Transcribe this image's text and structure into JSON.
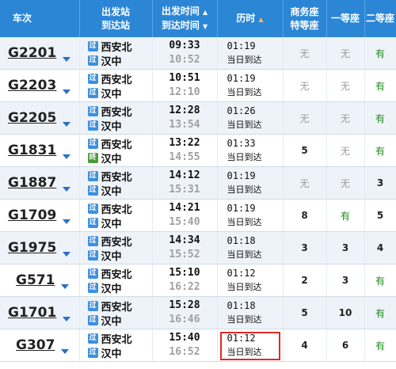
{
  "header": {
    "col_train": "车次",
    "col_from": "出发站",
    "col_to": "到达站",
    "col_dep_time": "出发时间",
    "col_arr_time": "到达时间",
    "col_duration": "历时",
    "col_business": "商务座",
    "col_special": "特等座",
    "col_first": "一等座",
    "col_second": "二等座"
  },
  "rows": [
    {
      "train": "G2201",
      "from": "西安北",
      "to": "汉中",
      "dep": "09:33",
      "arr": "10:52",
      "dur": "01:19",
      "arrive_day": "当日到达",
      "business": "无",
      "first": "无",
      "second": "有",
      "from_badge": "过",
      "to_badge": "过"
    },
    {
      "train": "G2203",
      "from": "西安北",
      "to": "汉中",
      "dep": "10:51",
      "arr": "12:10",
      "dur": "01:19",
      "arrive_day": "当日到达",
      "business": "无",
      "first": "无",
      "second": "有",
      "from_badge": "过",
      "to_badge": "过"
    },
    {
      "train": "G2205",
      "from": "西安北",
      "to": "汉中",
      "dep": "12:28",
      "arr": "13:54",
      "dur": "01:26",
      "arrive_day": "当日到达",
      "business": "无",
      "first": "无",
      "second": "有",
      "from_badge": "过",
      "to_badge": "过"
    },
    {
      "train": "G1831",
      "from": "西安北",
      "to": "汉中",
      "dep": "13:22",
      "arr": "14:55",
      "dur": "01:33",
      "arrive_day": "当日到达",
      "business": "5",
      "first": "无",
      "second": "有",
      "from_badge": "过",
      "to_badge": "终"
    },
    {
      "train": "G1887",
      "from": "西安北",
      "to": "汉中",
      "dep": "14:12",
      "arr": "15:31",
      "dur": "01:19",
      "arrive_day": "当日到达",
      "business": "无",
      "first": "无",
      "second": "3",
      "from_badge": "过",
      "to_badge": "过"
    },
    {
      "train": "G1709",
      "from": "西安北",
      "to": "汉中",
      "dep": "14:21",
      "arr": "15:40",
      "dur": "01:19",
      "arrive_day": "当日到达",
      "business": "8",
      "first": "有",
      "second": "5",
      "from_badge": "过",
      "to_badge": "过"
    },
    {
      "train": "G1975",
      "from": "西安北",
      "to": "汉中",
      "dep": "14:34",
      "arr": "15:52",
      "dur": "01:18",
      "arrive_day": "当日到达",
      "business": "3",
      "first": "3",
      "second": "4",
      "from_badge": "过",
      "to_badge": "过"
    },
    {
      "train": "G571",
      "from": "西安北",
      "to": "汉中",
      "dep": "15:10",
      "arr": "16:22",
      "dur": "01:12",
      "arrive_day": "当日到达",
      "business": "2",
      "first": "3",
      "second": "有",
      "from_badge": "过",
      "to_badge": "过"
    },
    {
      "train": "G1701",
      "from": "西安北",
      "to": "汉中",
      "dep": "15:28",
      "arr": "16:46",
      "dur": "01:18",
      "arrive_day": "当日到达",
      "business": "5",
      "first": "10",
      "second": "有",
      "from_badge": "过",
      "to_badge": "过"
    },
    {
      "train": "G307",
      "from": "西安北",
      "to": "汉中",
      "dep": "15:40",
      "arr": "16:52",
      "dur": "01:12",
      "arrive_day": "当日到达",
      "business": "4",
      "first": "6",
      "second": "有",
      "from_badge": "过",
      "to_badge": "过"
    }
  ],
  "colors": {
    "header_bg": "#2b86d6",
    "highlight": "#e02a2a",
    "have": "#1d8a1d",
    "pass_badge": "#3d8fde",
    "end_badge": "#4a9a3c"
  },
  "icons": {
    "sort_active": "sort-arrow-icon",
    "dropdown": "chevron-down-icon"
  }
}
